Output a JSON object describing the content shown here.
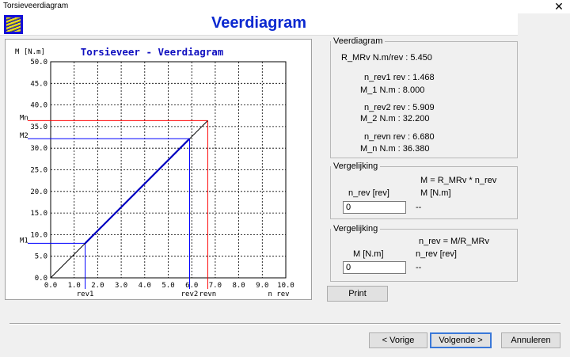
{
  "window": {
    "title": "Torsieveerdiagram",
    "close_glyph": "✕"
  },
  "header": {
    "title": "Veerdiagram",
    "logo_icon": "spring-icon"
  },
  "chart_data": {
    "type": "line",
    "title": "Torsieveer - Veerdiagram",
    "ylabel": "M [N.m]",
    "xlabel": "n rev",
    "xlim": [
      0,
      10
    ],
    "ylim": [
      0,
      50
    ],
    "x_ticks": [
      "0.0",
      "1.0",
      "2.0",
      "3.0",
      "4.0",
      "5.0",
      "6.0",
      "7.0",
      "8.0",
      "9.0",
      "10.0"
    ],
    "y_ticks": [
      "0.0",
      "5.0",
      "10.0",
      "15.0",
      "20.0",
      "25.0",
      "30.0",
      "35.0",
      "40.0",
      "45.0",
      "50.0"
    ],
    "grid": true,
    "series": [
      {
        "values": [
          [
            0,
            0
          ],
          [
            6.68,
            36.38
          ]
        ],
        "color": "#000000"
      },
      {
        "values": [
          [
            1.468,
            8.0
          ],
          [
            5.909,
            32.2
          ]
        ],
        "color": "#0000c0"
      }
    ],
    "markers": [
      {
        "label_y": "M1",
        "label_x": "rev1",
        "x": 1.468,
        "y": 8.0,
        "color": "#0000ff"
      },
      {
        "label_y": "M2",
        "label_x": "rev2",
        "x": 5.909,
        "y": 32.2,
        "color": "#0000ff"
      },
      {
        "label_y": "Mn",
        "label_x": "revn",
        "x": 6.68,
        "y": 36.38,
        "color": "#ff0000"
      }
    ]
  },
  "veerdiagram": {
    "legend": "Veerdiagram",
    "rmrv": "R_MRv  N.m/rev : 5.450",
    "nrev1": "n_rev1 rev : 1.468",
    "m1": "M_1     N.m : 8.000",
    "nrev2": "n_rev2 rev : 5.909",
    "m2": "M_2     N.m : 32.200",
    "nrevn": "n_revn rev : 6.680",
    "mn": "M_n     N.m : 36.380"
  },
  "verg1": {
    "legend": "Vergelijking",
    "formula": "M = R_MRv * n_rev",
    "in_label": "n_rev [rev]",
    "out_label": "M    [N.m]",
    "value": "0",
    "result": "--"
  },
  "verg2": {
    "legend": "Vergelijking",
    "formula": "n_rev = M/R_MRv",
    "in_label": "M    [N.m]",
    "out_label": "n_rev [rev]",
    "value": "0",
    "result": "--"
  },
  "buttons": {
    "print": "Print",
    "back": "< Vorige",
    "next": "Volgende >",
    "cancel": "Annuleren"
  }
}
